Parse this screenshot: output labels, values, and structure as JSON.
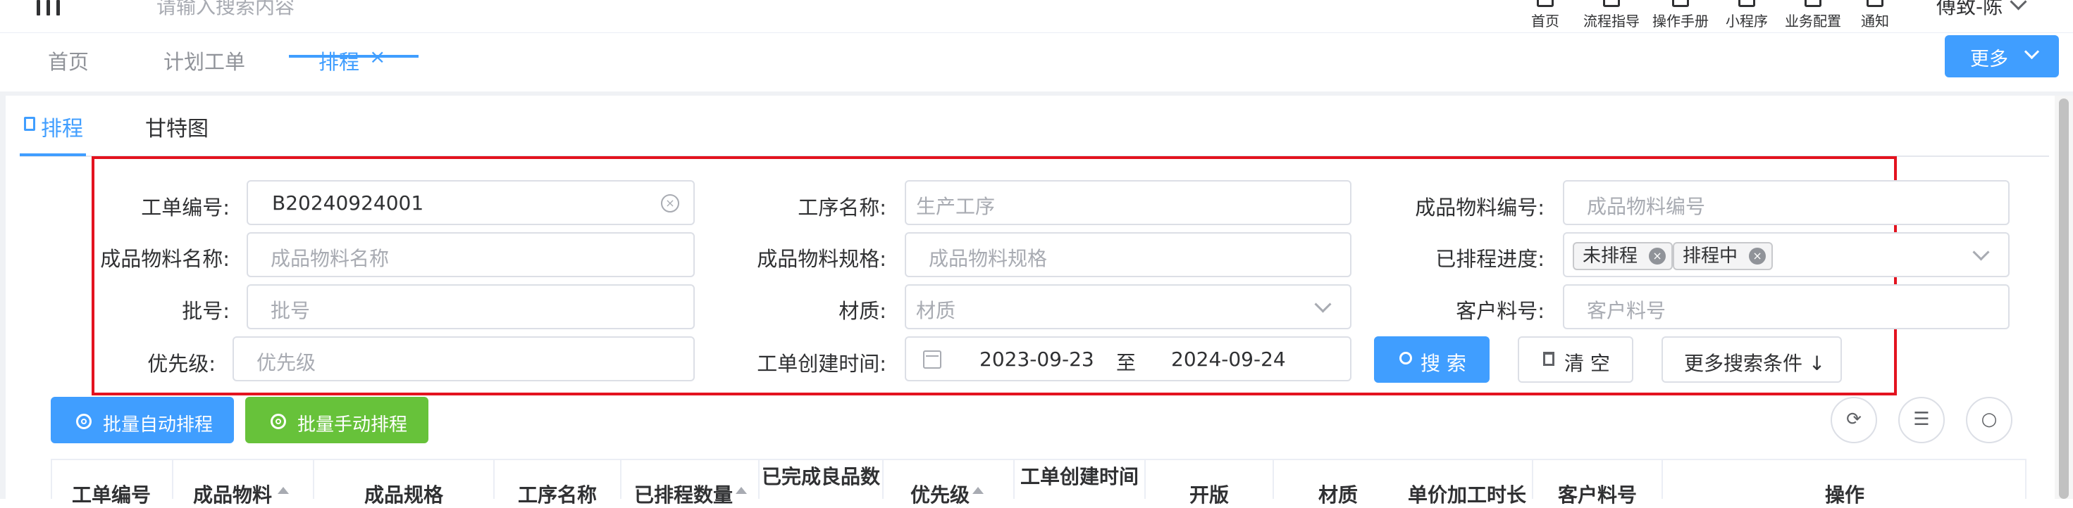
{
  "header": {
    "search_placeholder": "请输入搜索内容",
    "tools": [
      "首页",
      "流程指导",
      "操作手册",
      "小程序",
      "业务配置",
      "通知"
    ],
    "user_name": "傅致-陈"
  },
  "tabs": [
    {
      "label": "首页"
    },
    {
      "label": "计划工单"
    },
    {
      "label": "排程"
    }
  ],
  "tab_close": "×",
  "more_label": "更多",
  "subtabs": [
    "排程",
    "甘特图"
  ],
  "form": {
    "order_no_label": "工单编号:",
    "order_no_value": "B20240924001",
    "process_label": "工序名称:",
    "process_ph": "生产工序",
    "fp_code_label": "成品物料编号:",
    "fp_code_ph": "成品物料编号",
    "fp_name_label": "成品物料名称:",
    "fp_name_ph": "成品物料名称",
    "fp_spec_label": "成品物料规格:",
    "fp_spec_ph": "成品物料规格",
    "progress_label": "已排程进度:",
    "progress_tags": [
      "未排程",
      "排程中"
    ],
    "batch_label": "批号:",
    "batch_ph": "批号",
    "material_label": "材质:",
    "material_ph": "材质",
    "cust_no_label": "客户料号:",
    "cust_no_ph": "客户料号",
    "priority_label": "优先级:",
    "priority_ph": "优先级",
    "created_label": "工单创建时间:",
    "date_start": "2023-09-23",
    "date_sep": "至",
    "date_end": "2024-09-24",
    "search_btn": "搜 索",
    "clear_btn": "清 空",
    "more_cond_btn": "更多搜索条件 ↓"
  },
  "actions": {
    "auto_btn": "批量自动排程",
    "manual_btn": "批量手动排程"
  },
  "table": {
    "columns": [
      "工单编号",
      "成品物料",
      "成品规格",
      "工序名称",
      "已排程数量",
      "已完成良品数",
      "优先级",
      "工单创建时间",
      "开版",
      "材质",
      "单价加工时长",
      "客户料号",
      "操作"
    ]
  }
}
